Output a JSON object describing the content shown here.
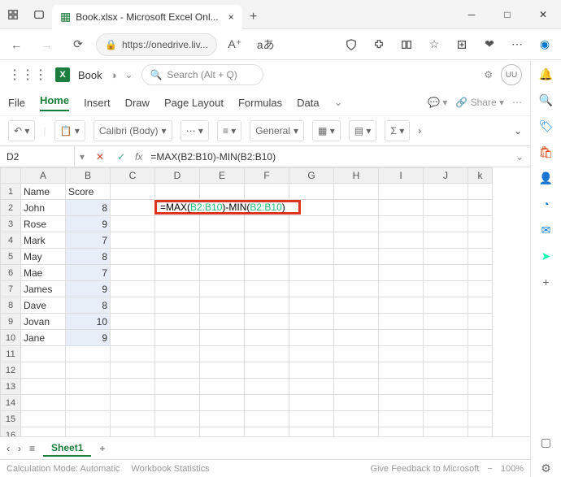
{
  "browser": {
    "tab_title": "Book.xlsx - Microsoft Excel Onl...",
    "url": "https://onedrive.liv..."
  },
  "appbar": {
    "book": "Book",
    "search_placeholder": "Search (Alt + Q)",
    "avatar": "UU"
  },
  "tabs": {
    "file": "File",
    "home": "Home",
    "insert": "Insert",
    "draw": "Draw",
    "page_layout": "Page Layout",
    "formulas": "Formulas",
    "data": "Data",
    "share": "Share"
  },
  "ribbon": {
    "font": "Calibri (Body)",
    "format": "General"
  },
  "formula_bar": {
    "name_box": "D2",
    "formula": "=MAX(B2:B10)-MIN(B2:B10)"
  },
  "columns": [
    "A",
    "B",
    "C",
    "D",
    "E",
    "F",
    "G",
    "H",
    "I",
    "J",
    "k"
  ],
  "row_headers": [
    "1",
    "2",
    "3",
    "4",
    "5",
    "6",
    "7",
    "8",
    "9",
    "10",
    "11",
    "12",
    "13",
    "14",
    "15",
    "16"
  ],
  "headers": {
    "a1": "Name",
    "b1": "Score"
  },
  "data_rows": [
    {
      "name": "John",
      "score": "8"
    },
    {
      "name": "Rose",
      "score": "9"
    },
    {
      "name": "Mark",
      "score": "7"
    },
    {
      "name": "May",
      "score": "8"
    },
    {
      "name": "Mae",
      "score": "7"
    },
    {
      "name": "James",
      "score": "9"
    },
    {
      "name": "Dave",
      "score": "8"
    },
    {
      "name": "Jovan",
      "score": "10"
    },
    {
      "name": "Jane",
      "score": "9"
    }
  ],
  "edit": {
    "p1": "=MAX(",
    "r1": "B2:B10",
    "p2": ")-MIN(",
    "r2": "B2:B10",
    "p3": ")"
  },
  "sheet": {
    "tab": "Sheet1"
  },
  "status": {
    "calc": "Calculation Mode: Automatic",
    "wb": "Workbook Statistics",
    "feedback": "Give Feedback to Microsoft",
    "zoom": "100%"
  }
}
